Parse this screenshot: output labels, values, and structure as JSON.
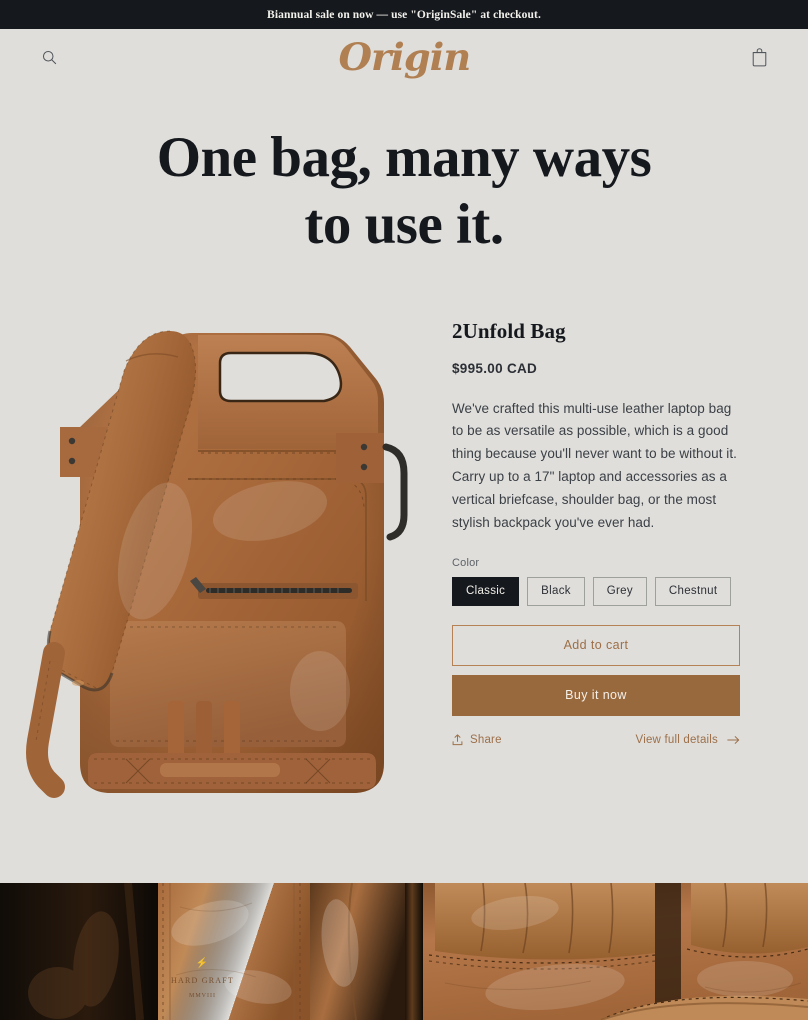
{
  "announcement": {
    "text": "Biannual sale on now — use \"OriginSale\" at checkout."
  },
  "header": {
    "search_icon": "search-icon",
    "logo": "Origin",
    "cart_icon": "shopping-bag-icon"
  },
  "hero": {
    "title_line1": "One bag, many ways",
    "title_line2": "to use it."
  },
  "product": {
    "title": "2Unfold Bag",
    "price": "$995.00 CAD",
    "description": "We've crafted this multi-use leather laptop bag to be as versatile as possible, which is a good thing because you'll never want to be without it. Carry up to a 17\" laptop and accessories as a vertical briefcase, shoulder bag, or the most stylish backpack you've ever had.",
    "option_label": "Color",
    "swatches": [
      {
        "label": "Classic",
        "selected": true
      },
      {
        "label": "Black",
        "selected": false
      },
      {
        "label": "Grey",
        "selected": false
      },
      {
        "label": "Chestnut",
        "selected": false
      }
    ],
    "add_to_cart_label": "Add to cart",
    "buy_now_label": "Buy it now",
    "share_label": "Share",
    "details_label": "View full details",
    "image_alt": "Brown leather 2Unfold backpack with shoulder strap"
  },
  "gallery": {
    "left_alt": "Close-up of leather edge stitching with embossed maker mark",
    "right_alt": "Close-up of folded leather panel with contrast stitching",
    "emboss_brand": "HARD GRAFT",
    "emboss_year": "MMVIII"
  },
  "colors": {
    "page_bg": "#dfdedb",
    "announcement_bg": "#15181d",
    "announcement_fg": "#f2f1ec",
    "brand_accent": "#b07f52",
    "buy_button_bg": "#99693e",
    "link_accent": "#9d7049",
    "text_primary": "#15181d",
    "text_body": "#3b4046",
    "leather": "#a9663a"
  }
}
